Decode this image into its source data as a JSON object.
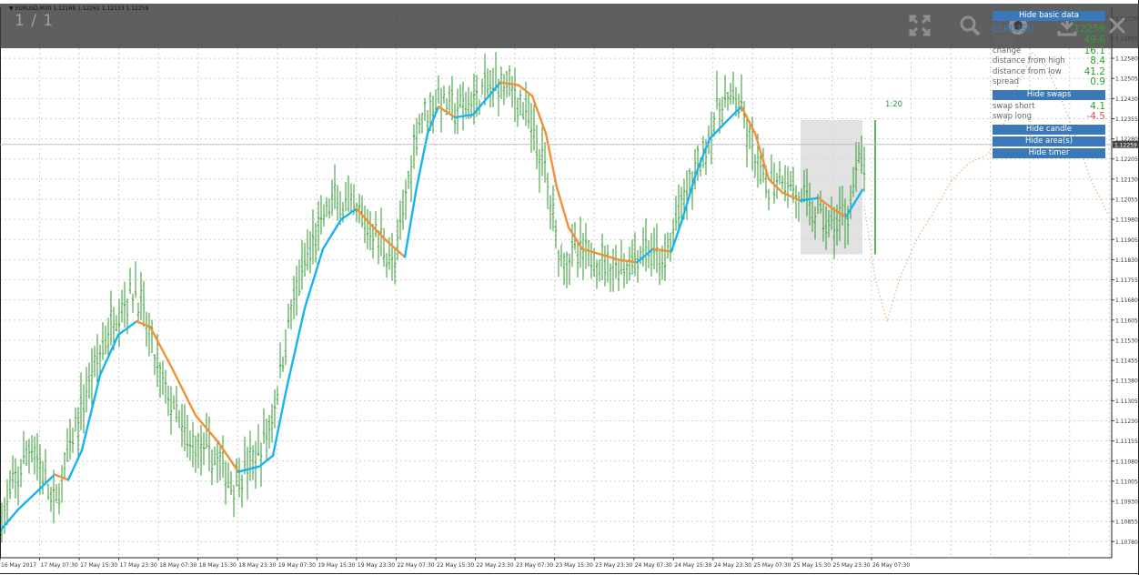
{
  "symbol_info": "EURUSD,M30  1.12168 1.12262 1.12133 1.12259",
  "viewer": {
    "page_counter": "1 / 1"
  },
  "panel": {
    "hide_basic_data": "Hide basic data",
    "symbol": "EURUSD",
    "price": "12259",
    "rows1": [
      {
        "label": "range",
        "value": "49.6",
        "sign": "pos"
      },
      {
        "label": "change",
        "value": "16.1",
        "sign": "pos"
      },
      {
        "label": "distance from high",
        "value": "8.4",
        "sign": "pos"
      },
      {
        "label": "distance from low",
        "value": "41.2",
        "sign": "pos"
      },
      {
        "label": "spread",
        "value": "0.9",
        "sign": "pos"
      }
    ],
    "hide_swaps": "Hide swaps",
    "rows2": [
      {
        "label": "swap short",
        "value": "4.1",
        "sign": "pos"
      },
      {
        "label": "swap long",
        "value": "-4.5",
        "sign": "neg"
      }
    ],
    "hide_candle": "Hide candle",
    "hide_areas": "Hide area(s)",
    "hide_timer": "Hide timer"
  },
  "annotation_timer": "1:20",
  "current_price_label": "1.12259",
  "colors": {
    "bars": "#2f9a2f",
    "ma_up": "#18b4f0",
    "ma_down": "#f0913a",
    "grid": "#cfcfcf",
    "panel_button": "#3a78b8",
    "positive": "#2fa12f",
    "negative": "#e05050"
  },
  "icons": [
    "fullscreen-icon",
    "zoom-icon",
    "share-icon",
    "download-icon",
    "close-icon"
  ],
  "chart_data": {
    "type": "ohlc",
    "y_ticks": [
      "1.12730",
      "1.12655",
      "1.12580",
      "1.12505",
      "1.12430",
      "1.12355",
      "1.12280",
      "1.12205",
      "1.12130",
      "1.12055",
      "1.11980",
      "1.11905",
      "1.11830",
      "1.11755",
      "1.11680",
      "1.11605",
      "1.11530",
      "1.11455",
      "1.11380",
      "1.11305",
      "1.11230",
      "1.11155",
      "1.11080",
      "1.11005",
      "1.10930",
      "1.10855",
      "1.10780"
    ],
    "x_ticks": [
      "16 May 2017",
      "17 May 07:30",
      "17 May 15:30",
      "17 May 23:30",
      "18 May 07:30",
      "18 May 15:30",
      "18 May 23:30",
      "19 May 07:30",
      "19 May 15:30",
      "19 May 23:30",
      "22 May 07:30",
      "22 May 15:30",
      "22 May 23:30",
      "23 May 07:30",
      "23 May 15:30",
      "23 May 23:30",
      "24 May 07:30",
      "24 May 15:30",
      "24 May 23:30",
      "25 May 07:30",
      "25 May 15:30",
      "25 May 23:30",
      "26 May 07:30"
    ],
    "ylim": [
      1.1072,
      1.1277
    ],
    "current_price": 1.12259,
    "path_points": [
      [
        0,
        1.1085
      ],
      [
        35,
        1.1115
      ],
      [
        60,
        1.109
      ],
      [
        75,
        1.111
      ],
      [
        100,
        1.114
      ],
      [
        130,
        1.1165
      ],
      [
        150,
        1.1172
      ],
      [
        175,
        1.114
      ],
      [
        205,
        1.1115
      ],
      [
        235,
        1.111
      ],
      [
        255,
        1.11
      ],
      [
        285,
        1.111
      ],
      [
        300,
        1.1125
      ],
      [
        320,
        1.1165
      ],
      [
        345,
        1.119
      ],
      [
        365,
        1.1205
      ],
      [
        390,
        1.12
      ],
      [
        420,
        1.119
      ],
      [
        435,
        1.118
      ],
      [
        445,
        1.1205
      ],
      [
        460,
        1.1235
      ],
      [
        480,
        1.1243
      ],
      [
        505,
        1.1238
      ],
      [
        530,
        1.1245
      ],
      [
        555,
        1.125
      ],
      [
        575,
        1.124
      ],
      [
        600,
        1.1215
      ],
      [
        615,
        1.1185
      ],
      [
        635,
        1.1185
      ],
      [
        660,
        1.1183
      ],
      [
        685,
        1.118
      ],
      [
        710,
        1.1187
      ],
      [
        730,
        1.118
      ],
      [
        745,
        1.12
      ],
      [
        770,
        1.122
      ],
      [
        790,
        1.124
      ],
      [
        810,
        1.1243
      ],
      [
        825,
        1.1225
      ],
      [
        840,
        1.121
      ],
      [
        860,
        1.1215
      ],
      [
        880,
        1.1205
      ],
      [
        900,
        1.12
      ],
      [
        915,
        1.1195
      ],
      [
        930,
        1.12
      ],
      [
        945,
        1.122
      ],
      [
        955,
        1.1215
      ]
    ],
    "ma_path": [
      [
        0,
        1.1082
      ],
      [
        20,
        1.109
      ],
      [
        45,
        1.1098
      ],
      [
        60,
        1.1103
      ],
      [
        75,
        1.1101
      ],
      [
        90,
        1.1112
      ],
      [
        110,
        1.114
      ],
      [
        130,
        1.1155
      ],
      [
        150,
        1.116
      ],
      [
        165,
        1.1158
      ],
      [
        190,
        1.1142
      ],
      [
        215,
        1.1125
      ],
      [
        240,
        1.1115
      ],
      [
        262,
        1.1104
      ],
      [
        285,
        1.1106
      ],
      [
        300,
        1.111
      ],
      [
        315,
        1.1135
      ],
      [
        335,
        1.1165
      ],
      [
        355,
        1.1187
      ],
      [
        375,
        1.1198
      ],
      [
        392,
        1.1202
      ],
      [
        405,
        1.1197
      ],
      [
        425,
        1.119
      ],
      [
        445,
        1.1184
      ],
      [
        458,
        1.121
      ],
      [
        470,
        1.123
      ],
      [
        482,
        1.124
      ],
      [
        500,
        1.1236
      ],
      [
        520,
        1.1237
      ],
      [
        535,
        1.1243
      ],
      [
        550,
        1.1249
      ],
      [
        570,
        1.1248
      ],
      [
        585,
        1.1244
      ],
      [
        600,
        1.123
      ],
      [
        612,
        1.121
      ],
      [
        625,
        1.1195
      ],
      [
        640,
        1.1187
      ],
      [
        660,
        1.1185
      ],
      [
        680,
        1.1183
      ],
      [
        700,
        1.1182
      ],
      [
        718,
        1.1187
      ],
      [
        738,
        1.1186
      ],
      [
        750,
        1.1198
      ],
      [
        765,
        1.1215
      ],
      [
        780,
        1.1228
      ],
      [
        800,
        1.1235
      ],
      [
        815,
        1.124
      ],
      [
        830,
        1.123
      ],
      [
        845,
        1.1213
      ],
      [
        860,
        1.1208
      ],
      [
        880,
        1.1205
      ],
      [
        900,
        1.1206
      ],
      [
        915,
        1.1202
      ],
      [
        930,
        1.1199
      ],
      [
        948,
        1.1209
      ]
    ],
    "forecast_path": [
      [
        950,
        1.1203
      ],
      [
        962,
        1.1176
      ],
      [
        975,
        1.116
      ],
      [
        990,
        1.1177
      ],
      [
        1010,
        1.1192
      ],
      [
        1025,
        1.12
      ],
      [
        1045,
        1.1212
      ],
      [
        1065,
        1.1219
      ],
      [
        1085,
        1.1222
      ],
      [
        1100,
        1.123
      ],
      [
        1115,
        1.1245
      ],
      [
        1135,
        1.126
      ],
      [
        1150,
        1.1255
      ],
      [
        1170,
        1.124
      ],
      [
        1200,
        1.1212
      ],
      [
        1218,
        1.12
      ]
    ],
    "range_box": {
      "x1": 880,
      "x2": 948,
      "y1": 1.1235,
      "y2": 1.1185
    }
  }
}
